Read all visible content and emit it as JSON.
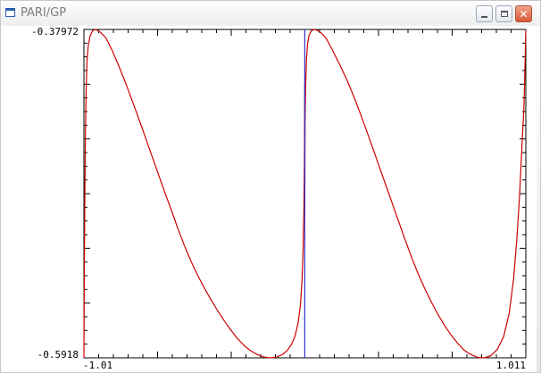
{
  "window": {
    "title": "PARI/GP",
    "icon": "app-icon",
    "controls": {
      "minimize": "minimize-icon",
      "maximize": "maximize-icon",
      "close": "close-icon"
    }
  },
  "chart_data": {
    "type": "line",
    "x_range": [
      -1.01,
      1.011
    ],
    "y_range": [
      -0.5918,
      -0.37972
    ],
    "tick_labels": {
      "y_top": "-0.37972",
      "y_bottom": "-0.5918",
      "x_left": "-1.01",
      "x_right": "1.011"
    },
    "grid": false,
    "series": [
      {
        "color": "#cc0000",
        "x": [
          -1.01,
          -1.0085,
          -1.006,
          -1.003,
          -1.0,
          -0.996,
          -0.99,
          -0.982,
          -0.97,
          -0.955,
          -0.935,
          -0.91,
          -0.88,
          -0.85,
          -0.82,
          -0.79,
          -0.76,
          -0.73,
          -0.7,
          -0.67,
          -0.64,
          -0.61,
          -0.58,
          -0.55,
          -0.52,
          -0.49,
          -0.46,
          -0.43,
          -0.4,
          -0.37,
          -0.34,
          -0.31,
          -0.28,
          -0.25,
          -0.22,
          -0.19,
          -0.16,
          -0.13,
          -0.1,
          -0.08,
          -0.06,
          -0.045,
          -0.03,
          -0.02,
          -0.013,
          -0.008,
          -0.004,
          -0.0015,
          0.0
        ],
        "y": [
          -0.5918,
          -0.545,
          -0.49,
          -0.447,
          -0.42,
          -0.4,
          -0.39,
          -0.384,
          -0.3805,
          -0.3797,
          -0.3815,
          -0.385,
          -0.3935,
          -0.4035,
          -0.414,
          -0.4255,
          -0.437,
          -0.449,
          -0.461,
          -0.473,
          -0.485,
          -0.4965,
          -0.5085,
          -0.5195,
          -0.5295,
          -0.5385,
          -0.5465,
          -0.554,
          -0.561,
          -0.5675,
          -0.5735,
          -0.579,
          -0.5835,
          -0.587,
          -0.5895,
          -0.5912,
          -0.5918,
          -0.5914,
          -0.5895,
          -0.587,
          -0.583,
          -0.578,
          -0.569,
          -0.558,
          -0.543,
          -0.524,
          -0.497,
          -0.463,
          -0.415
        ]
      },
      {
        "color": "#cc0000",
        "x": [
          0.0,
          0.0015,
          0.004,
          0.008,
          0.013,
          0.02,
          0.03,
          0.045,
          0.06,
          0.08,
          0.1,
          0.13,
          0.16,
          0.19,
          0.22,
          0.25,
          0.28,
          0.31,
          0.34,
          0.37,
          0.4,
          0.43,
          0.46,
          0.49,
          0.52,
          0.55,
          0.58,
          0.61,
          0.64,
          0.67,
          0.7,
          0.73,
          0.76,
          0.79,
          0.82,
          0.85,
          0.88,
          0.91,
          0.935,
          0.955,
          0.97,
          0.982,
          0.99,
          0.996,
          1.0,
          1.003,
          1.006,
          1.0085,
          1.011
        ],
        "y": [
          -0.495,
          -0.44,
          -0.415,
          -0.398,
          -0.389,
          -0.3833,
          -0.3805,
          -0.3797,
          -0.3805,
          -0.3825,
          -0.386,
          -0.394,
          -0.4025,
          -0.4115,
          -0.4215,
          -0.4325,
          -0.444,
          -0.456,
          -0.468,
          -0.48,
          -0.492,
          -0.504,
          -0.516,
          -0.5275,
          -0.538,
          -0.5475,
          -0.556,
          -0.564,
          -0.571,
          -0.5772,
          -0.5825,
          -0.587,
          -0.5897,
          -0.5914,
          -0.5918,
          -0.5905,
          -0.5865,
          -0.578,
          -0.563,
          -0.541,
          -0.515,
          -0.488,
          -0.465,
          -0.447,
          -0.437,
          -0.427,
          -0.41,
          -0.395,
          -0.38
        ]
      },
      {
        "color": "#3333cc",
        "x": [
          0.0,
          0.0
        ],
        "y": [
          -0.37972,
          -0.5918
        ]
      }
    ]
  }
}
